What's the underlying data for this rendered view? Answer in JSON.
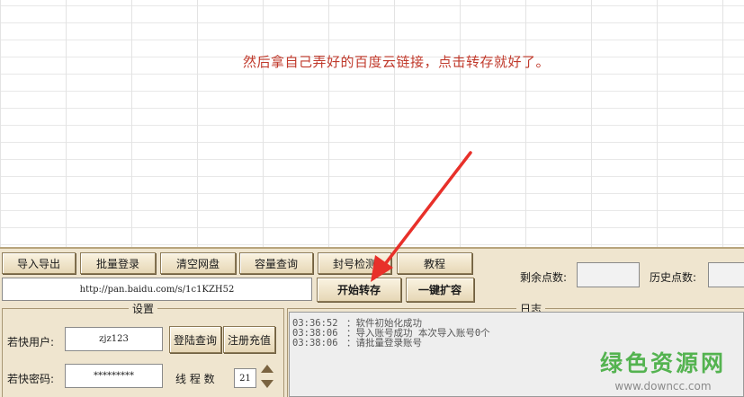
{
  "caption": "然后拿自己弄好的百度云链接，点击转存就好了。",
  "toolbar": {
    "import_export": "导入导出",
    "batch_login": "批量登录",
    "clear_disk": "清空网盘",
    "capacity_query": "容量查询",
    "ban_check": "封号检测",
    "tutorial": "教程"
  },
  "url_field": {
    "value": "http://pan.baidu.com/s/1c1KZH52"
  },
  "actions": {
    "start_transfer": "开始转存",
    "one_click_expand": "一键扩容"
  },
  "stats": {
    "remaining_points_label": "剩余点数:",
    "history_points_label": "历史点数:"
  },
  "settings": {
    "title": "设置",
    "user_label": "若快用户:",
    "user_value": "zjz123",
    "password_label": "若快密码:",
    "password_value": "*********",
    "login_query": "登陆查询",
    "register_recharge": "注册充值",
    "thread_label": "线 程 数",
    "thread_value": "21"
  },
  "log": {
    "title": "日志",
    "entries": [
      {
        "time": "03:36:52",
        "message": "：软件初始化成功"
      },
      {
        "time": "03:38:06",
        "message": "：导入账号成功 本次导入账号0个"
      },
      {
        "time": "03:38:06",
        "message": "：请批量登录账号"
      }
    ]
  },
  "watermark": {
    "main": "绿色资源网",
    "sub": "www.downcc.com"
  },
  "colors": {
    "caption": "#c0392b",
    "panel": "#efe5cf",
    "arrow": "#e8302a",
    "watermark": "#3aa935"
  }
}
